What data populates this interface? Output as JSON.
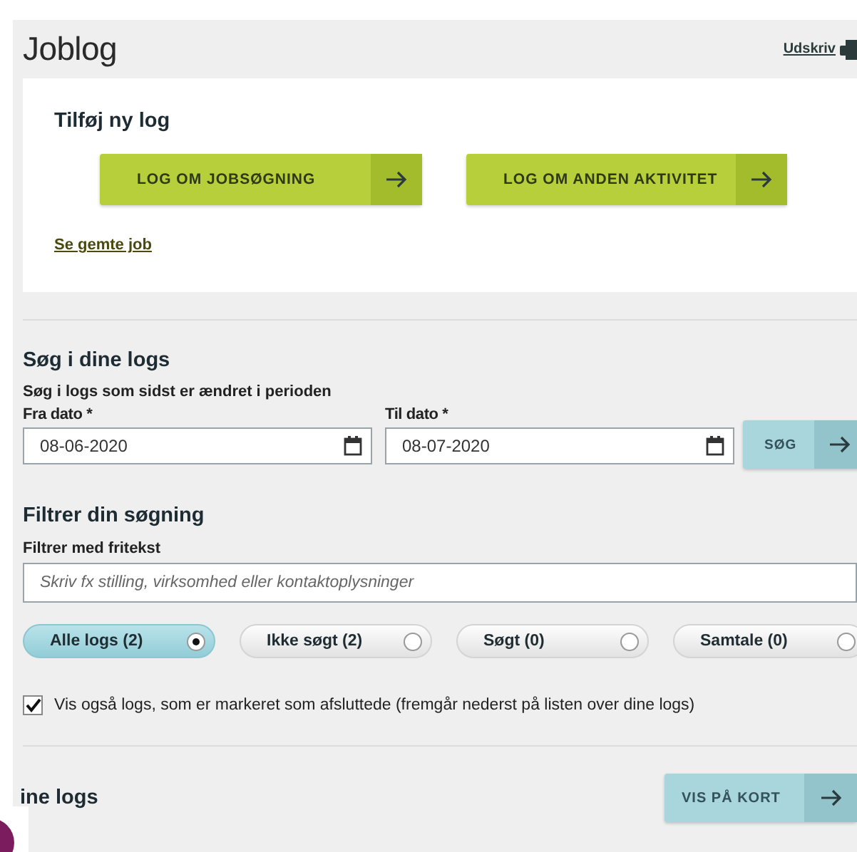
{
  "page": {
    "title": "Joblog",
    "print_link": "Udskriv"
  },
  "add_log": {
    "heading": "Tilføj ny log",
    "buttons": [
      "LOG OM JOBSØGNING",
      "LOG OM ANDEN AKTIVITET"
    ],
    "saved_jobs_link": "Se gemte job"
  },
  "search": {
    "heading": "Søg i dine logs",
    "subheading": "Søg i logs som sidst er ændret i perioden",
    "from": {
      "label": "Fra dato *",
      "value": "08-06-2020"
    },
    "to": {
      "label": "Til dato *",
      "value": "08-07-2020"
    },
    "button": "SØG"
  },
  "filter": {
    "heading": "Filtrer din søgning",
    "freetext_label": "Filtrer med fritekst",
    "freetext": {
      "placeholder": "Skriv fx stilling, virksomhed eller kontaktoplysninger"
    },
    "options": [
      {
        "label": "Alle logs (2)",
        "selected": true
      },
      {
        "label": "Ikke søgt (2)",
        "selected": false
      },
      {
        "label": "Søgt (0)",
        "selected": false
      },
      {
        "label": "Samtale (0)",
        "selected": false
      }
    ],
    "show_closed": {
      "label": "Vis også logs, som er markeret som afsluttede (fremgår nederst på listen over dine logs)",
      "checked": true
    }
  },
  "logs": {
    "heading": "ine logs",
    "map_button": "VIS PÅ KORT"
  }
}
